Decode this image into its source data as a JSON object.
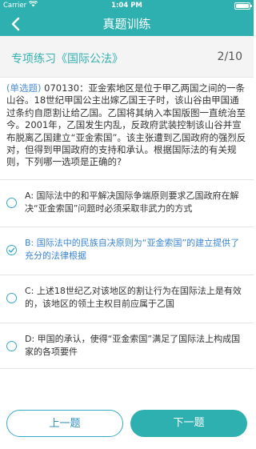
{
  "status_bar": {
    "carrier": "Carrier",
    "time": "1:04 PM"
  },
  "nav": {
    "title": "真题训练"
  },
  "section": {
    "title": "专项练习《国际公法》",
    "counter": "2/10"
  },
  "question": {
    "type_label": "(单选题)",
    "text": " 070130：亚金索地区是位于甲乙两国之间的一条山谷。18世纪甲国公主出嫁乙国王子时，该山谷由甲国通过条约自愿割让给乙国。乙国将其纳入本国版图一直统治至今。2001年，乙国发生内乱，反政府武装控制该山谷并宣布脱离乙国建立“亚金索国”。该主张遭到乙国政府的强烈反对，但得到甲国政府的支持和承认。根据国际法的有关规则，下列哪一选项是正确的?"
  },
  "options": [
    {
      "text": "A: 国际法中的和平解决国际争端原则要求乙国政府在解决“亚金索国”问题时必须采取非武力的方式",
      "selected": false
    },
    {
      "text": "B: 国际法中的民族自决原则为“亚金索国”的建立提供了充分的法律根据",
      "selected": true
    },
    {
      "text": "C: 上述18世纪乙对该地区的割让行为在国际法上是有效的，该地区的领土主权目前应属于乙国",
      "selected": false
    },
    {
      "text": "D: 甲国的承认，使得“亚金索国”满足了国际法上构成国家的各项要件",
      "selected": false
    }
  ],
  "buttons": {
    "prev": "上一题",
    "next": "下一题"
  },
  "colors": {
    "header": "#2fb0b0",
    "accent_text": "#35b1b1",
    "selected_text": "#3a86d4",
    "radio_border": "#35a8c8"
  }
}
